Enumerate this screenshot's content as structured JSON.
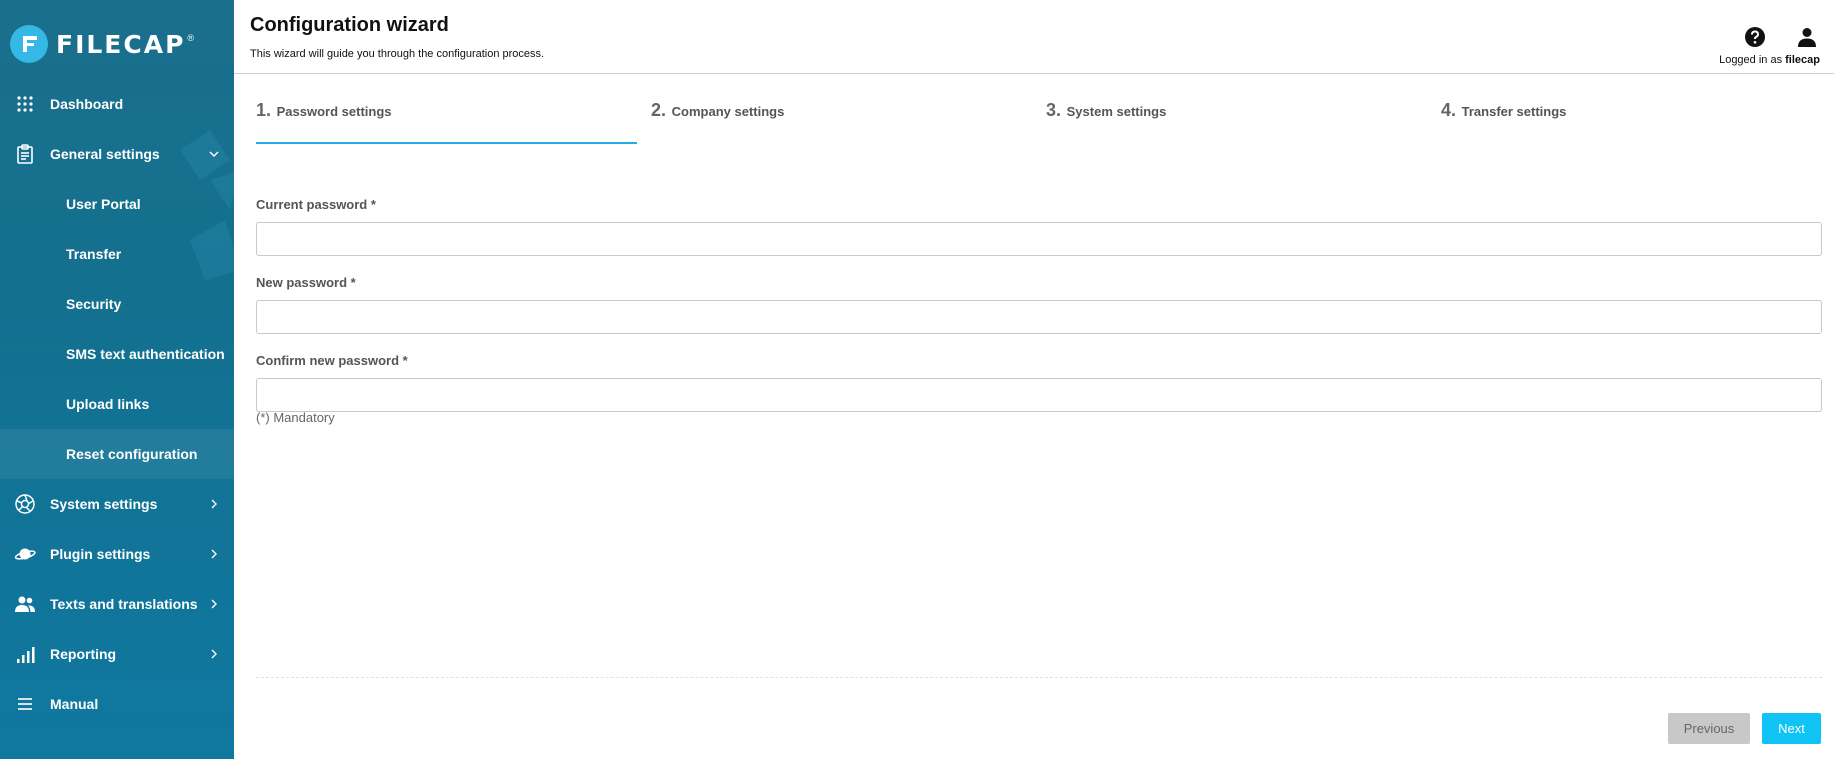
{
  "brand": {
    "name": "FILECAP",
    "registered": "®"
  },
  "sidebar": {
    "items": [
      {
        "label": "Dashboard",
        "icon": "grid-icon"
      },
      {
        "label": "General settings",
        "icon": "clipboard-icon",
        "expanded": true
      },
      {
        "label": "User Portal"
      },
      {
        "label": "Transfer"
      },
      {
        "label": "Security"
      },
      {
        "label": "SMS text authentication"
      },
      {
        "label": "Upload links"
      },
      {
        "label": "Reset configuration",
        "active": true
      },
      {
        "label": "System settings",
        "icon": "aperture-icon"
      },
      {
        "label": "Plugin settings",
        "icon": "planet-icon"
      },
      {
        "label": "Texts and translations",
        "icon": "users-icon"
      },
      {
        "label": "Reporting",
        "icon": "signal-bars-icon"
      },
      {
        "label": "Manual",
        "icon": "menu-lines-icon"
      }
    ]
  },
  "header": {
    "title": "Configuration wizard",
    "subtitle": "This wizard will guide you through the configuration process.",
    "login_prefix": "Logged in as",
    "username": "filecap"
  },
  "steps": [
    {
      "num": "1.",
      "label": "Password settings",
      "active": true
    },
    {
      "num": "2.",
      "label": "Company settings"
    },
    {
      "num": "3.",
      "label": "System settings"
    },
    {
      "num": "4.",
      "label": "Transfer settings"
    }
  ],
  "form": {
    "fields": [
      {
        "label": "Current password *",
        "value": ""
      },
      {
        "label": "New password *",
        "value": ""
      },
      {
        "label": "Confirm new password *",
        "value": ""
      }
    ],
    "mandatory_note": "(*) Mandatory"
  },
  "buttons": {
    "previous": "Previous",
    "next": "Next"
  },
  "colors": {
    "sidebar": "#13708f",
    "accent": "#22aee0",
    "next_button": "#0fc3f5",
    "prev_button": "#c8c8c8"
  }
}
